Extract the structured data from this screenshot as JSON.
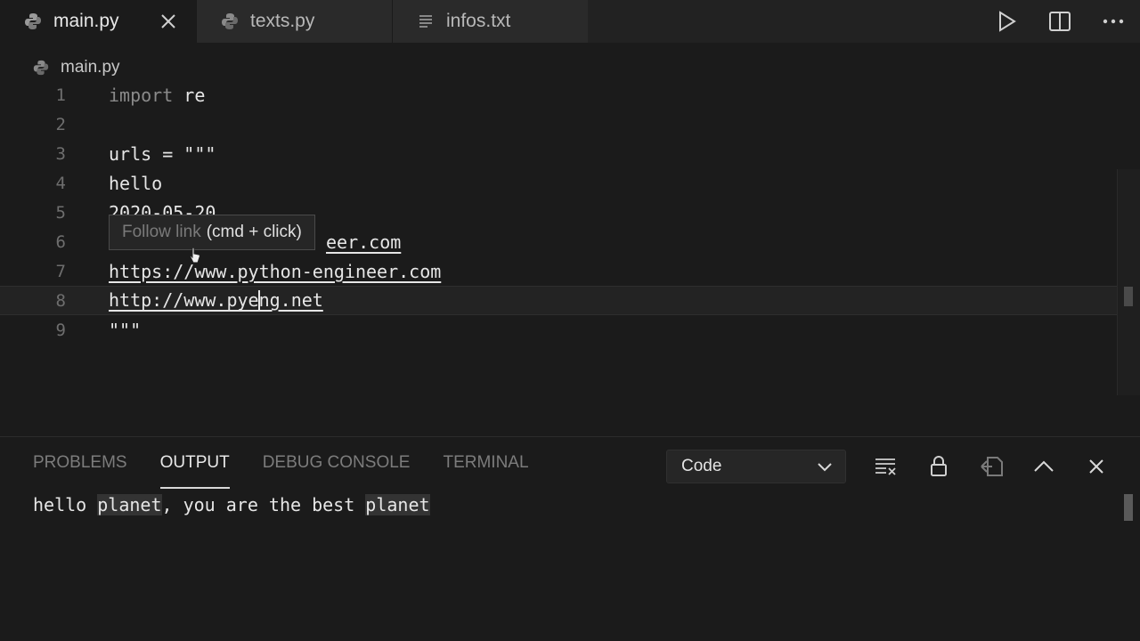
{
  "tabs": [
    {
      "label": "main.py",
      "icon": "python-icon",
      "active": true
    },
    {
      "label": "texts.py",
      "icon": "python-icon",
      "active": false
    },
    {
      "label": "infos.txt",
      "icon": "text-file-icon",
      "active": false
    }
  ],
  "actions": [
    "run-icon",
    "split-editor-icon",
    "more-actions-icon"
  ],
  "breadcrumb": {
    "file": "main.py"
  },
  "editor": {
    "lines": [
      {
        "num": "1",
        "kw": "import",
        "rest": " re"
      },
      {
        "num": "2",
        "text": ""
      },
      {
        "num": "3",
        "text": "urls = \"\"\""
      },
      {
        "num": "4",
        "text": "hello"
      },
      {
        "num": "5",
        "text": "2020-05-20"
      },
      {
        "num": "6",
        "link_tail": "eer.com"
      },
      {
        "num": "7",
        "link": "https://www.python-engineer.com"
      },
      {
        "num": "8",
        "link_a": "http://www.pye",
        "link_b": "ng.net"
      },
      {
        "num": "9",
        "text": "\"\"\""
      }
    ],
    "tooltip": {
      "dim": "Follow link",
      "text": "(cmd + click)"
    }
  },
  "panel": {
    "tabs": [
      "PROBLEMS",
      "OUTPUT",
      "DEBUG CONSOLE",
      "TERMINAL"
    ],
    "active_tab": "OUTPUT",
    "channel": "Code",
    "tools": [
      "clear-output-icon",
      "lock-scroll-icon",
      "open-log-icon",
      "maximize-panel-icon",
      "close-panel-icon"
    ],
    "output": {
      "p1": "hello ",
      "h1": "planet",
      "p2": ", you are the best ",
      "h2": "planet"
    }
  },
  "colors": {
    "background": "#1b1b1b",
    "tabbar": "#222222",
    "accent": "#e8e8e8"
  }
}
